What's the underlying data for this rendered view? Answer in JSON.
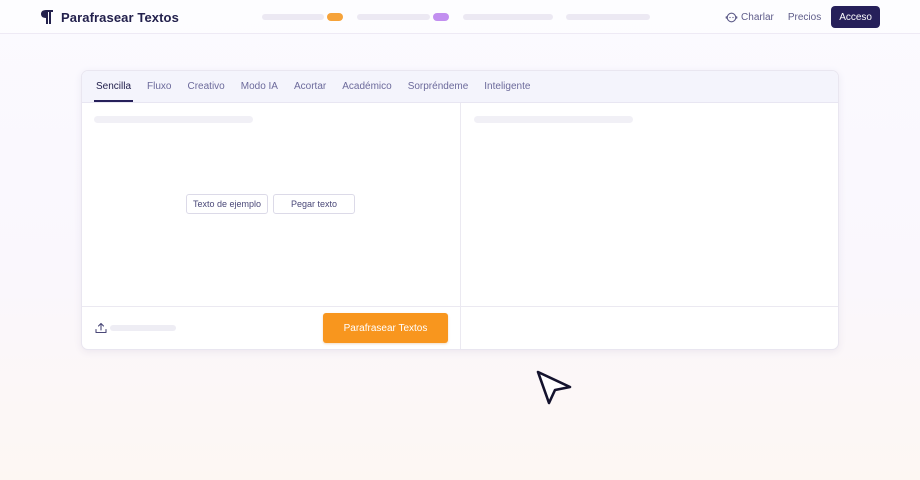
{
  "header": {
    "logo_text": "Parafrasear Textos",
    "charlar_label": "Charlar",
    "precios_label": "Precios",
    "acceso_label": "Acceso",
    "badge_colors": [
      "#f6a33a",
      "#c28ff0"
    ],
    "icons": {
      "logo": "pilcrow-icon",
      "charlar": "chat-bubble-icon"
    }
  },
  "editor": {
    "tabs": [
      "Sencilla",
      "Fluxo",
      "Creativo",
      "Modo IA",
      "Acortar",
      "Académico",
      "Sorpréndeme",
      "Inteligente"
    ],
    "active_tab": "Sencilla",
    "sample_button": "Texto de ejemplo",
    "paste_button": "Pegar texto",
    "submit_button": "Parafrasear Textos",
    "icons": {
      "upload": "upload-icon"
    },
    "accent_color": "#f8961e",
    "brand_color": "#26205a"
  },
  "overlay": {
    "icon": "mouse-pointer-icon"
  }
}
